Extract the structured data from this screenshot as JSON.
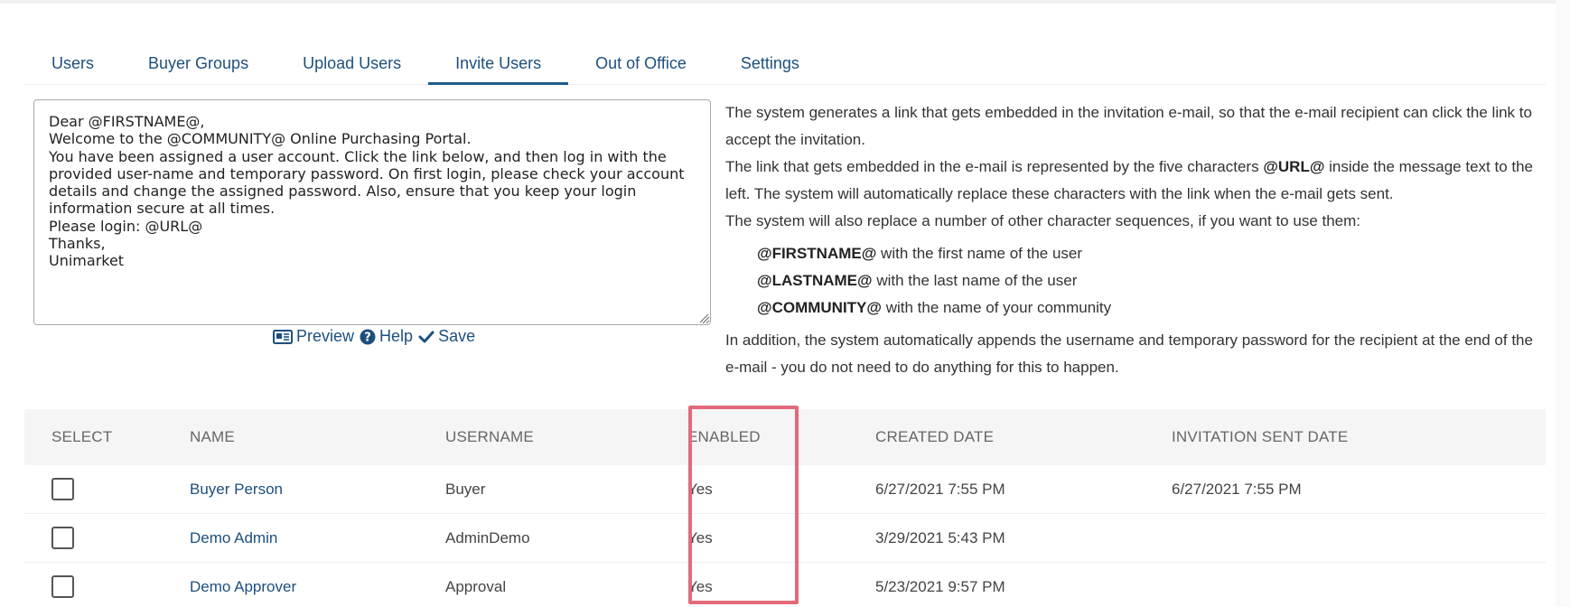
{
  "tabs": [
    {
      "label": "Users",
      "active": false
    },
    {
      "label": "Buyer Groups",
      "active": false
    },
    {
      "label": "Upload Users",
      "active": false
    },
    {
      "label": "Invite Users",
      "active": true
    },
    {
      "label": "Out of Office",
      "active": false
    },
    {
      "label": "Settings",
      "active": false
    }
  ],
  "message": {
    "text": "Dear @FIRSTNAME@,\nWelcome to the @COMMUNITY@ Online Purchasing Portal.\nYou have been assigned a user account. Click the link below, and then log in with the provided user-name and temporary password. On first login, please check your account details and change the assigned password. Also, ensure that you keep your login information secure at all times.\nPlease login: @URL@\nThanks,\nUnimarket"
  },
  "editor_actions": {
    "preview_label": "Preview",
    "help_label": "Help",
    "save_label": "Save"
  },
  "help": {
    "para1": "The system generates a link that gets embedded in the invitation e-mail, so that the e-mail recipient can click the link to accept the invitation.",
    "para2_before": "The link that gets embedded in the e-mail is represented by the five characters ",
    "para2_token": "@URL@",
    "para2_after": " inside the message text to the left. The system will automatically replace these characters with the link when the e-mail gets sent.",
    "para3": "The system will also replace a number of other character sequences, if you want to use them:",
    "tokens": [
      {
        "token": "@FIRSTNAME@",
        "desc": " with the first name of the user"
      },
      {
        "token": "@LASTNAME@",
        "desc": " with the last name of the user"
      },
      {
        "token": "@COMMUNITY@",
        "desc": " with the name of your community"
      }
    ],
    "para4": "In addition, the system automatically appends the username and temporary password for the recipient at the end of the e-mail - you do not need to do anything for this to happen."
  },
  "table": {
    "headers": {
      "select": "SELECT",
      "name": "NAME",
      "username": "USERNAME",
      "enabled": "ENABLED",
      "created": "CREATED DATE",
      "invite": "INVITATION SENT DATE"
    },
    "rows": [
      {
        "name": "Buyer Person",
        "username": "Buyer",
        "enabled": "Yes",
        "created": "6/27/2021 7:55 PM",
        "invite": "6/27/2021 7:55 PM"
      },
      {
        "name": "Demo Admin",
        "username": "AdminDemo",
        "enabled": "Yes",
        "created": "3/29/2021 5:43 PM",
        "invite": ""
      },
      {
        "name": "Demo Approver",
        "username": "Approval",
        "enabled": "Yes",
        "created": "5/23/2021 9:57 PM",
        "invite": ""
      }
    ]
  },
  "colors": {
    "link": "#1d4f7e",
    "active_tab_underline": "#1d5c8d",
    "highlight": "#e26a7a"
  }
}
